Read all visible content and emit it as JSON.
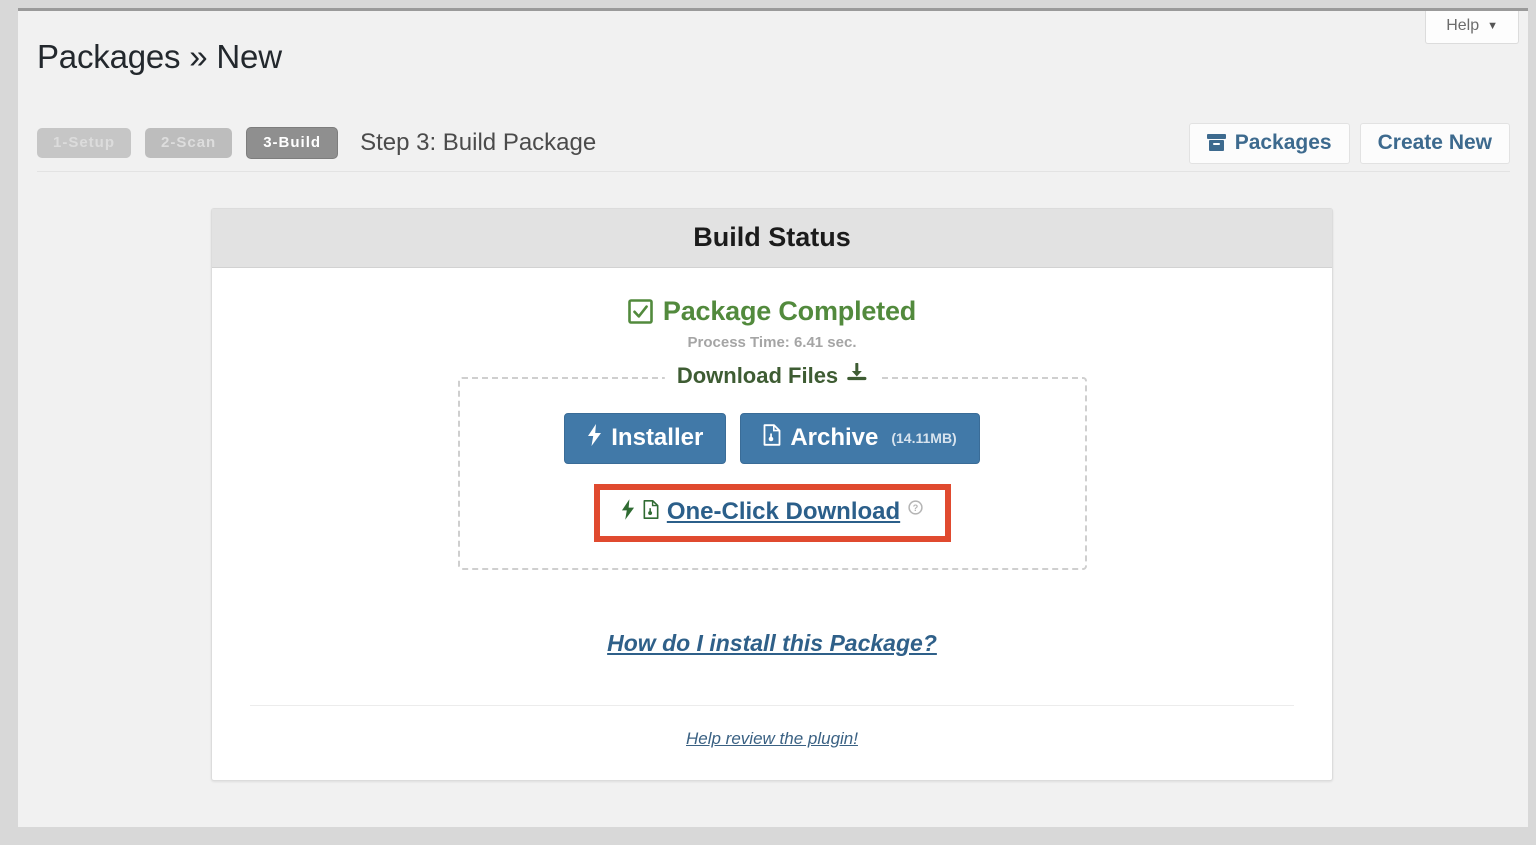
{
  "window": {
    "help_tab_label": "Help",
    "help_tab_caret": "▼"
  },
  "header": {
    "page_title": "Packages » New"
  },
  "steps": {
    "items": [
      {
        "label": "1-Setup",
        "state": "done"
      },
      {
        "label": "2-Scan",
        "state": "done"
      },
      {
        "label": "3-Build",
        "state": "active"
      }
    ],
    "caption": "Step 3: Build Package",
    "actions": [
      {
        "label": "Packages",
        "icon": "archive-box-icon"
      },
      {
        "label": "Create New",
        "icon": ""
      }
    ]
  },
  "card": {
    "title": "Build Status",
    "status": {
      "icon": "checkbox-checked-icon",
      "text": "Package Completed",
      "color": "#528a3d",
      "process_time": "Process Time: 6.41 sec."
    },
    "download": {
      "legend": "Download Files",
      "legend_icon": "download-icon",
      "buttons": [
        {
          "label": "Installer",
          "icon": "lightning-bolt-icon",
          "size": ""
        },
        {
          "label": "Archive",
          "icon": "file-icon",
          "size": "(14.11MB)"
        }
      ],
      "one_click": {
        "label": "One-Click Download",
        "icons": [
          "lightning-bolt-icon",
          "file-icon"
        ],
        "help_icon": "question-circle-icon",
        "highlight_color": "#e04a2f"
      }
    },
    "install_link": "How do I install this Package?",
    "review_link": "Help review the plugin!"
  }
}
